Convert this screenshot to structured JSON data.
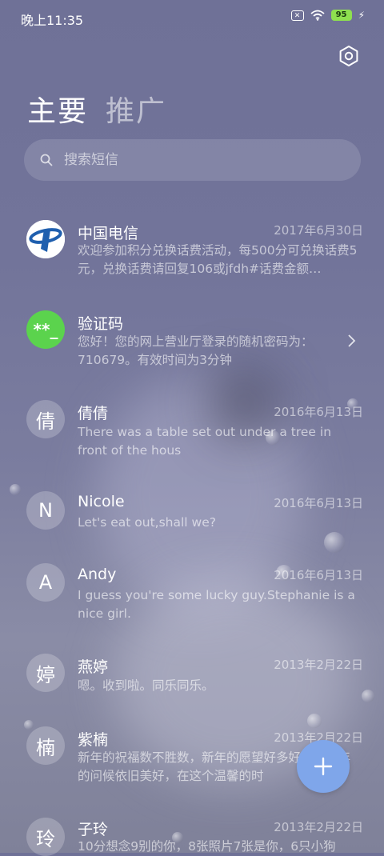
{
  "status_bar": {
    "time": "晚上11:35",
    "sim_icon": "sim-off-icon",
    "wifi_icon": "wifi-icon",
    "battery_level": "95",
    "charging_icon": "bolt-icon"
  },
  "header": {
    "settings_icon": "settings-hexagon-icon"
  },
  "tabs": [
    {
      "label": "主要",
      "active": true
    },
    {
      "label": "推广",
      "active": false
    }
  ],
  "search": {
    "placeholder": "搜索短信",
    "icon": "search-icon"
  },
  "conversations": [
    {
      "avatar_text": "",
      "avatar_icon": "china-telecom-logo",
      "name": "中国电信",
      "date": "2017年6月30日",
      "preview": "欢迎参加积分兑换话费活动，每500分可兑换话费5元，兑换话费请回复106或jfdh#话费金额…"
    },
    {
      "avatar_text": "**_",
      "name": "验证码",
      "date": "",
      "preview": "您好！您的网上营业厅登录的随机密码为：710679。有效时间为3分钟",
      "has_chevron": true
    },
    {
      "avatar_text": "倩",
      "name": "倩倩",
      "date": "2016年6月13日",
      "preview": "There was a table set out under a tree in front of the hous"
    },
    {
      "avatar_text": "N",
      "name": "Nicole",
      "date": "2016年6月13日",
      "preview": "Let's eat out,shall we?"
    },
    {
      "avatar_text": "A",
      "name": "Andy",
      "date": "2016年6月13日",
      "preview": "I guess you're some lucky guy.Stephanie is a nice girl."
    },
    {
      "avatar_text": "婷",
      "name": "燕婷",
      "date": "2013年2月22日",
      "preview": "嗯。收到啦。同乐同乐。"
    },
    {
      "avatar_text": "楠",
      "name": "紫楠",
      "date": "2013年2月22日",
      "preview": "新年的祝福数不胜数，新年的愿望好多好多，新年的问候依旧美好，在这个温馨的时"
    },
    {
      "avatar_text": "玲",
      "name": "子玲",
      "date": "2013年2月22日",
      "preview": "10分想念9别的你，8张照片7张是你，6只小狗"
    }
  ],
  "fab": {
    "icon": "plus-icon"
  },
  "colors": {
    "accent_fab": "#7fa6ea",
    "code_avatar": "#5bd34d",
    "battery": "#8ee04f",
    "background": "#72749a"
  }
}
